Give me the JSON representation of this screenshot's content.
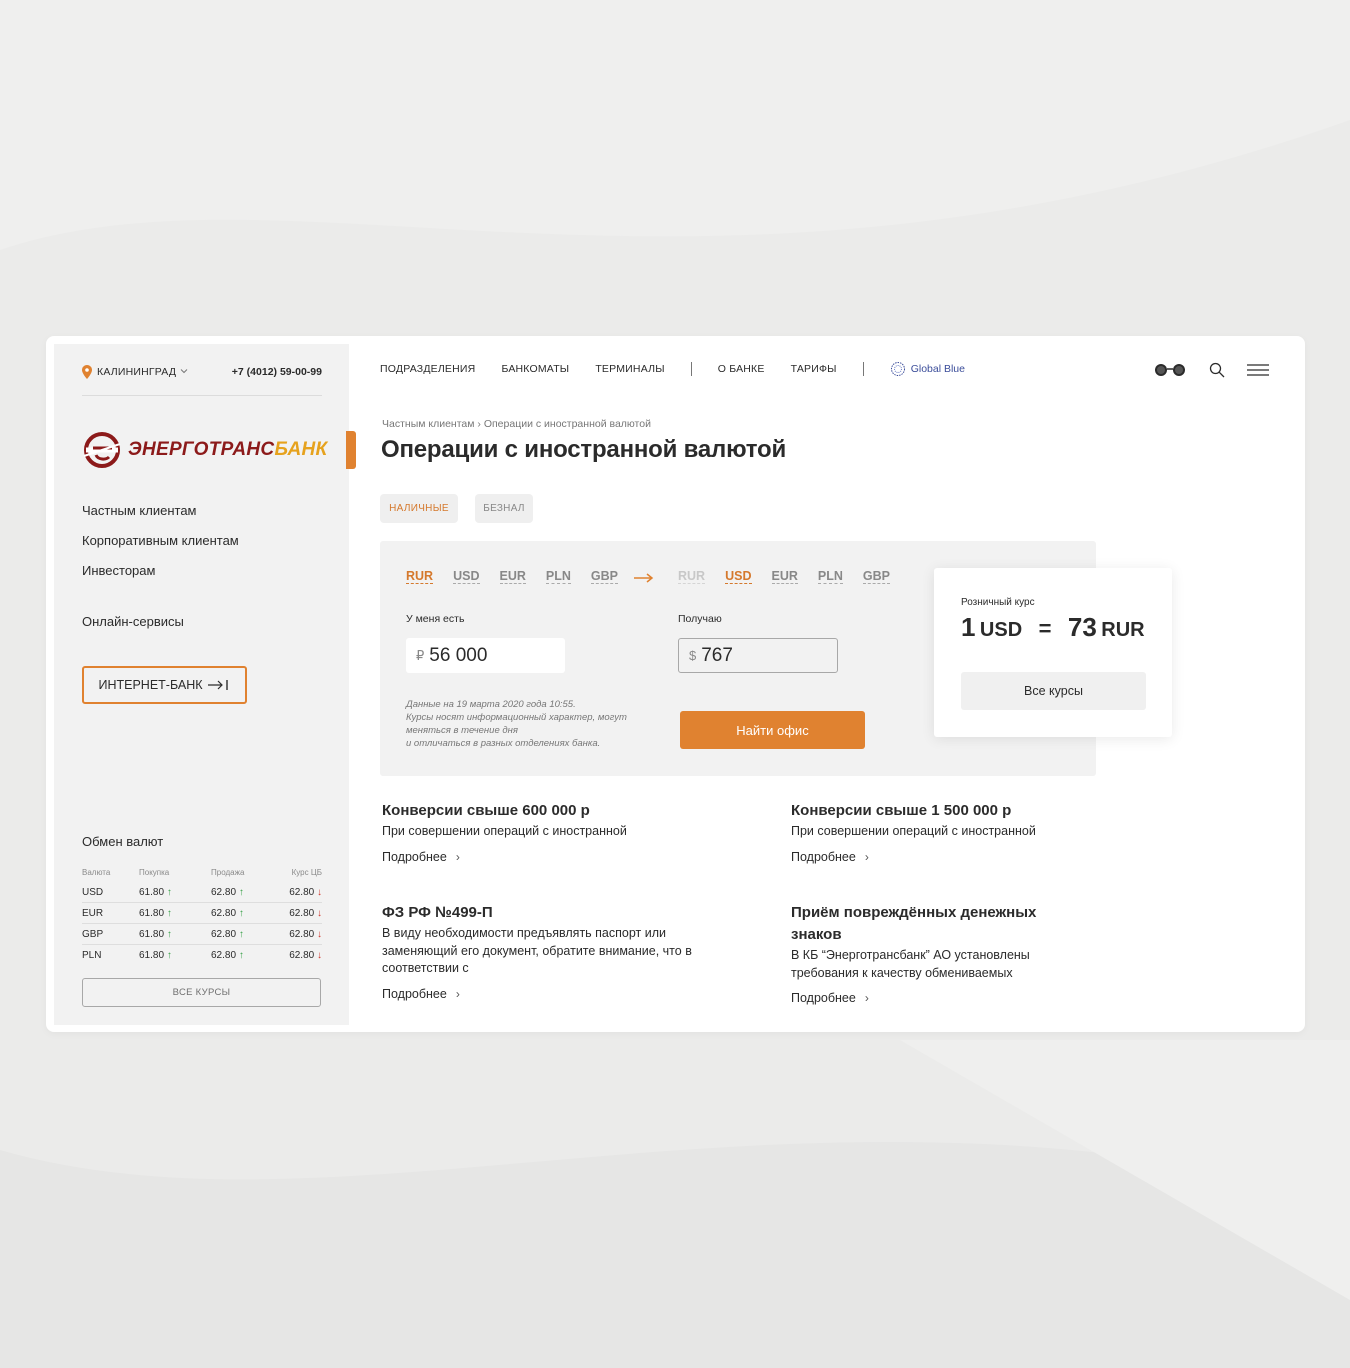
{
  "sidebar": {
    "city": "КАЛИНИНГРАД",
    "phone": "+7 (4012) 59-00-99",
    "logo": {
      "part1": "ЭНЕРГОТРАНС",
      "part2": "БАНК"
    },
    "nav": [
      "Частным клиентам",
      "Корпоративным клиентам",
      "Инвесторам"
    ],
    "online": "Онлайн-сервисы",
    "internet_bank": "ИНТЕРНЕТ-БАНК"
  },
  "exchange": {
    "title": "Обмен валют",
    "headers": [
      "Валюта",
      "Покупка",
      "Продажа",
      "Курс ЦБ"
    ],
    "rows": [
      {
        "cur": "USD",
        "buy": "61.80",
        "sell": "62.80",
        "cb": "62.80"
      },
      {
        "cur": "EUR",
        "buy": "61.80",
        "sell": "62.80",
        "cb": "62.80"
      },
      {
        "cur": "GBP",
        "buy": "61.80",
        "sell": "62.80",
        "cb": "62.80"
      },
      {
        "cur": "PLN",
        "buy": "61.80",
        "sell": "62.80",
        "cb": "62.80"
      }
    ],
    "all_label": "ВСЕ КУРСЫ"
  },
  "topnav": {
    "items": [
      "ПОДРАЗДЕЛЕНИЯ",
      "БАНКОМАТЫ",
      "ТЕРМИНАЛЫ",
      "О БАНКЕ",
      "ТАРИФЫ"
    ],
    "global_blue": "Global Blue"
  },
  "breadcrumbs": [
    "Частным клиентам",
    "Операции с иностранной валютой"
  ],
  "page_title": "Операции с иностранной валютой",
  "tabs": [
    "НАЛИЧНЫЕ",
    "БЕЗНАЛ"
  ],
  "calculator": {
    "from_currencies": [
      "RUR",
      "USD",
      "EUR",
      "PLN",
      "GBP"
    ],
    "to_currencies": [
      "RUR",
      "USD",
      "EUR",
      "PLN",
      "GBP"
    ],
    "have_label": "У меня есть",
    "get_label": "Получаю",
    "have_symbol": "₽",
    "have_value": "56 000",
    "get_symbol": "$",
    "get_value": "767",
    "note": [
      "Данные на 19 марта 2020 года 10:55.",
      "Курсы носят информационный характер, могут",
      "меняться в течение дня",
      "и отличаться в разных отделениях банка."
    ],
    "find_button": "Найти офис"
  },
  "retail_rate": {
    "label": "Розничный курс",
    "from_amount": "1",
    "from_cur": "USD",
    "eq": "=",
    "to_amount": "73",
    "to_cur": "RUR",
    "button": "Все курсы"
  },
  "news": [
    {
      "title": "Конверсии свыше  600 000 р",
      "desc": "При совершении операций  с иностранной",
      "more": "Подробнее"
    },
    {
      "title": "Конверсии свыше 1 500 000 р",
      "desc": "При совершении операций  с иностранной",
      "more": "Подробнее"
    },
    {
      "title": "ФЗ РФ  №499-П",
      "desc": "В виду необходимости предъявлять паспорт или заменяющий его документ, обратите внимание, что в соответствии с",
      "more": "Подробнее"
    },
    {
      "title": "Приём повреждённых денежных знаков",
      "desc": "В КБ “Энерготрансбанк” АО установлены требования к качеству обмениваемых",
      "more": "Подробнее"
    }
  ],
  "colors": {
    "accent": "#e08230",
    "brand_red": "#8c1a1a",
    "brand_gold": "#e6a21d"
  }
}
